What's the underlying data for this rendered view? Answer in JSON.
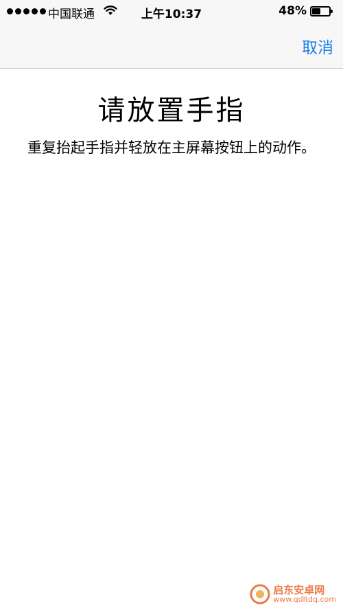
{
  "status_bar": {
    "carrier": "中国联通",
    "time": "上午10:37",
    "battery_percent": "48%",
    "battery_level": 0.48
  },
  "nav": {
    "cancel_label": "取消"
  },
  "main": {
    "title": "请放置手指",
    "description": "重复抬起手指并轻放在主屏幕按钮上的动作。"
  },
  "watermark": {
    "name": "启东安卓网",
    "url": "www.qdltdq.com"
  },
  "colors": {
    "accent": "#1a7fe8",
    "watermark": "#e8632a"
  },
  "icons": [
    "signal-dots-icon",
    "wifi-icon",
    "battery-icon",
    "watermark-logo-icon"
  ]
}
